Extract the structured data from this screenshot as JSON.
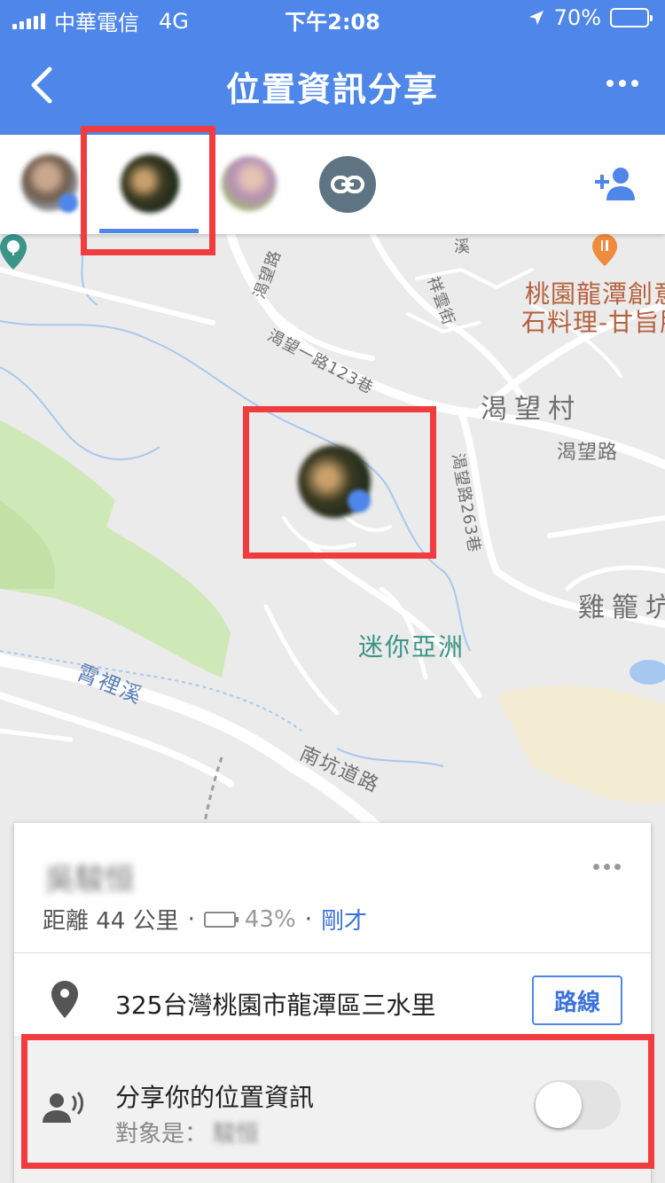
{
  "status_bar": {
    "carrier": "中華電信",
    "network": "4G",
    "time": "下午2:08",
    "battery_percent": "70%",
    "battery_level": 0.7
  },
  "app_bar": {
    "title": "位置資訊分享",
    "back_icon": "back-arrow-icon",
    "more_icon": "more-options-icon"
  },
  "people_bar": {
    "selected_index": 1,
    "link_icon": "link-icon",
    "add_person_icon": "add-person-icon"
  },
  "map": {
    "labels": {
      "poi_restaurant_line1": "桃園龍潭創意",
      "poi_restaurant_line2": "石料理-甘旨肥",
      "village_kewang": "渴望村",
      "road_kewang": "渴望路",
      "road_kewang_263": "渴望路263巷",
      "road_kewang_1_123": "渴望一路123巷",
      "road_kewang_top": "渴望路",
      "street_xiangyun": "祥雲街",
      "area_jilongkeng": "雞籠坑",
      "poi_mini_asia": "迷你亞洲",
      "stream_xiali": "霄裡溪",
      "road_nankeng": "南坑道路",
      "stream_top": "溪"
    }
  },
  "card": {
    "person_name": "吳駿恒",
    "distance": "距離 44 公里",
    "separator": "·",
    "battery_text": "43%",
    "battery_level": 0.43,
    "updated": "剛才",
    "address": "325台灣桃園市龍潭區三水里",
    "route_button": "路線",
    "share_title": "分享你的位置資訊",
    "share_target_label": "對象是：",
    "share_target_name": "駿恒",
    "share_toggle_on": false
  }
}
